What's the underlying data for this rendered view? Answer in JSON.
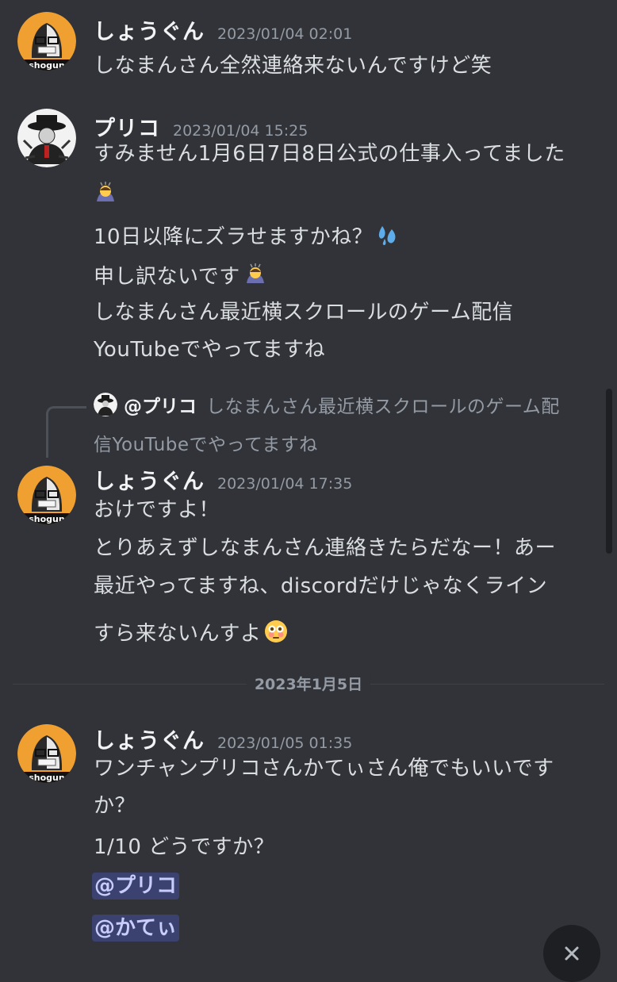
{
  "messages": [
    {
      "username": "しょうぐん",
      "timestamp": "2023/01/04 02:01",
      "avatar": "shogun-avatar",
      "avatar_text": "shogun",
      "lines": [
        "しなまんさん全然連絡来ないんですけど笑"
      ]
    },
    {
      "username": "プリコ",
      "timestamp": "2023/01/04 15:25",
      "avatar": "puriko-avatar",
      "lines": [
        "すみません1月6日7日8日公式の仕事入ってました",
        "10日以降にズラせますかね？",
        "申し訳ないです",
        "しなまんさん最近横スクロールのゲーム配信",
        "YouTubeでやってますね"
      ],
      "emojis": [
        "bowing-person-emoji",
        "sweat-droplets-emoji",
        "bowing-person-emoji"
      ]
    },
    {
      "reply": {
        "name": "@プリコ",
        "text": "しなまんさん最近横スクロールのゲーム配",
        "text_cont": "信YouTubeでやってますね"
      },
      "username": "しょうぐん",
      "timestamp": "2023/01/04 17:35",
      "avatar": "shogun-avatar",
      "lines": [
        "おけですよ！",
        "とりあえずしなまんさん連絡きたらだなー！あー",
        "最近やってますね、discordだけじゃなくライン",
        "すら来ないんすよ"
      ],
      "emojis": [
        "flushed-face-emoji"
      ]
    },
    {
      "username": "しょうぐん",
      "timestamp": "2023/01/05 01:35",
      "avatar": "shogun-avatar",
      "lines": [
        "ワンチャンプリコさんかてぃさん俺でもいいです",
        "か？",
        "1/10 どうですか？"
      ],
      "mentions": [
        "@プリコ",
        "@かてぃ"
      ]
    }
  ],
  "date_divider": "2023年1月5日",
  "colors": {
    "background": "#313338",
    "text": "#dbdee1",
    "username": "#f2f3f5",
    "timestamp": "#949ba4",
    "mention_bg": "#3c4270",
    "mention_text": "#c9cdfb",
    "avatar_orange": "#f0a030"
  },
  "icons": {
    "close_button": "close-icon"
  }
}
